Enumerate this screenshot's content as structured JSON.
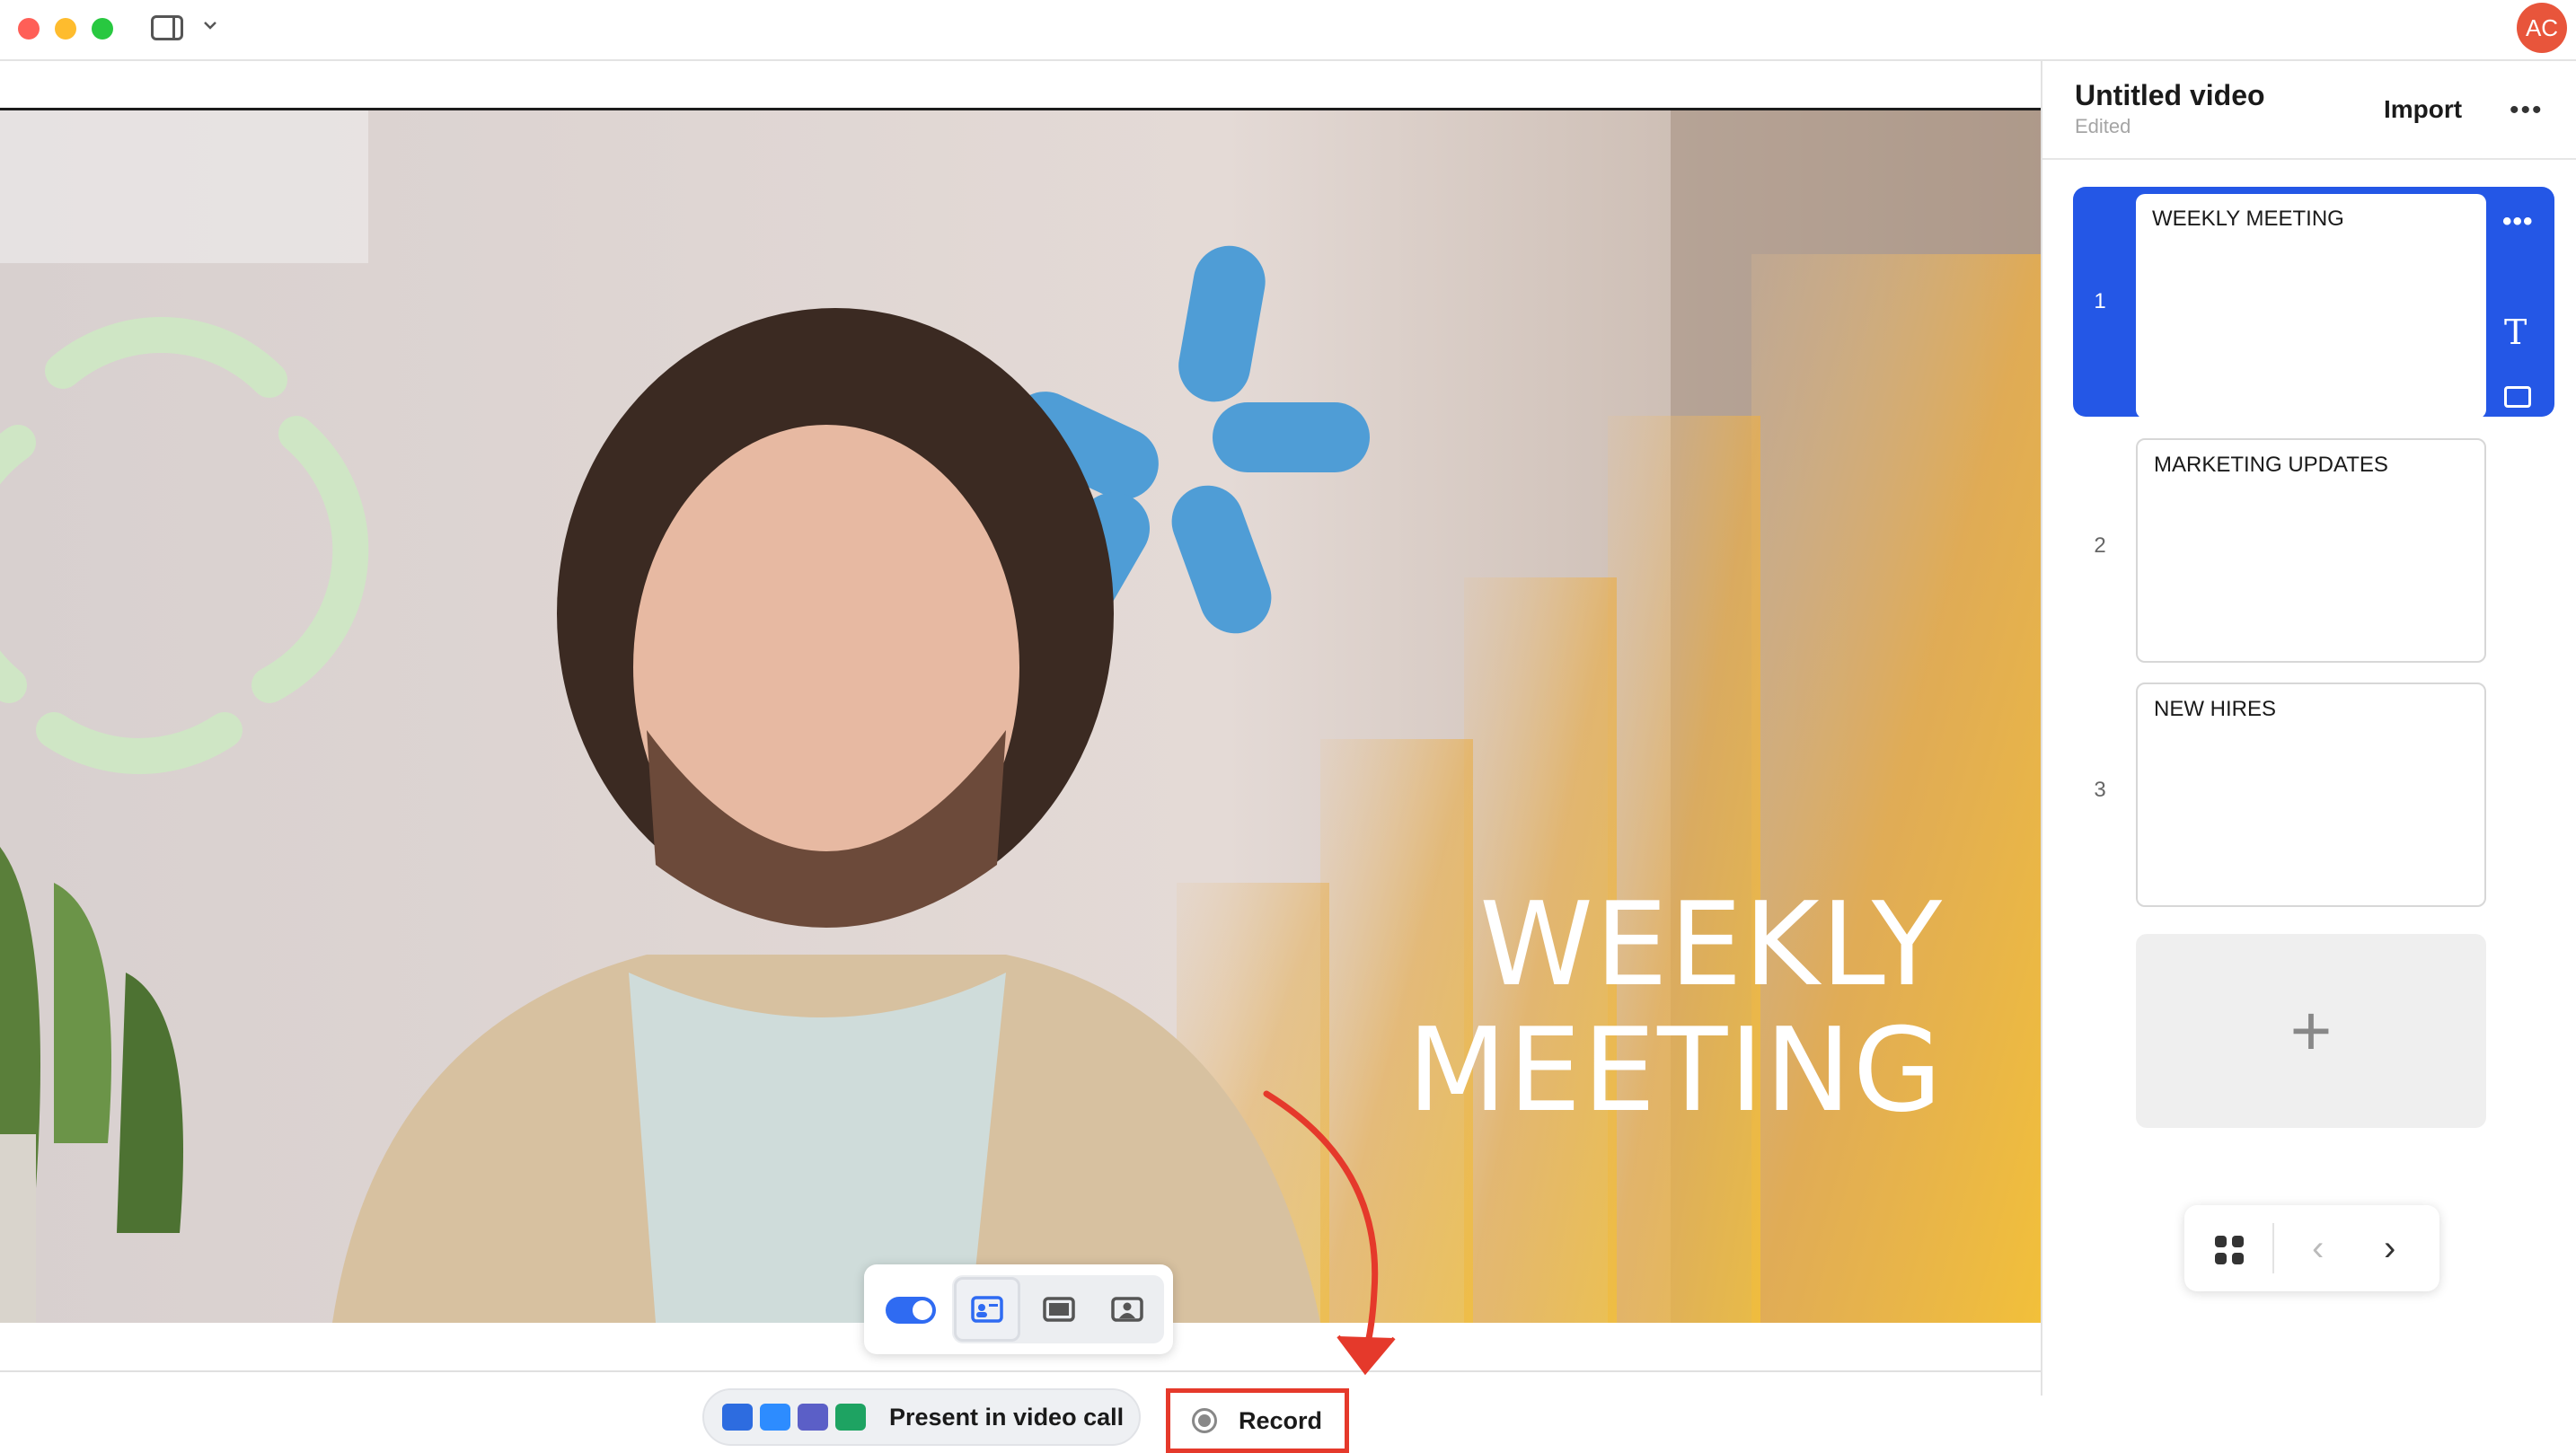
{
  "window": {
    "avatar_initials": "AC"
  },
  "stage": {
    "slide_title_line1": "WEEKLY",
    "slide_title_line2": "MEETING"
  },
  "bottom_bar": {
    "present_label": "Present in video call",
    "record_label": "Record"
  },
  "panel": {
    "title": "Untitled video",
    "subtitle": "Edited",
    "import_label": "Import",
    "more_label": "•••",
    "slides": [
      {
        "number": "1",
        "label": "WEEKLY MEETING"
      },
      {
        "number": "2",
        "label": "MARKETING UPDATES"
      },
      {
        "number": "3",
        "label": "NEW HIRES"
      }
    ],
    "add_slide_label": "+"
  },
  "colors": {
    "accent": "#2457e6",
    "record_highlight": "#e5392b",
    "avatar": "#e8553b",
    "slide_overlay": "#f0b73a"
  },
  "icons": [
    "sidebar-icon",
    "chevron-down-icon",
    "record-icon",
    "text-icon",
    "image-icon",
    "grid-icon",
    "chevron-left-icon",
    "chevron-right-icon"
  ]
}
